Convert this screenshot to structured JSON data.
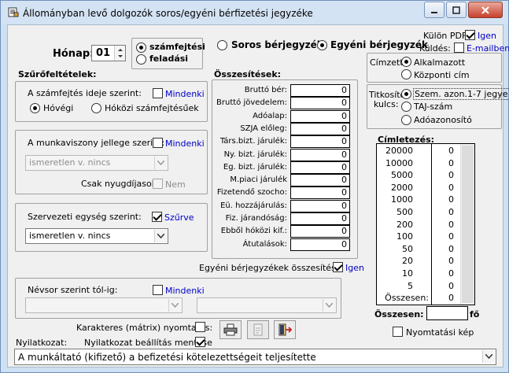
{
  "window": {
    "title": "Állományban levő dolgozók soros/egyéni bérfizetési jegyzéke"
  },
  "month": {
    "label": "Hónap:",
    "value": "01"
  },
  "mode": {
    "options": [
      "számfejtési",
      "feladási"
    ],
    "selected": 0
  },
  "filters": {
    "title": "Szűrőfeltételek:",
    "time": {
      "label": "A számfejtés ideje szerint:",
      "all": "Mindenki",
      "all_checked": false,
      "options": [
        "Hóvégi",
        "Hóközi számfejtésűek"
      ],
      "selected": 0
    },
    "employment": {
      "label": "A munkaviszony jellege szerint:",
      "all": "Mindenki",
      "all_checked": false,
      "value": "ismeretlen v. nincs",
      "pension_label": "Csak nyugdíjasok:",
      "pension_value": "Nem"
    },
    "org": {
      "label": "Szervezeti egység szerint:",
      "filtered": "Szűrve",
      "filtered_checked": true,
      "value": "ismeretlen v. nincs"
    },
    "names": {
      "label": "Névsor szerint tól-ig:",
      "all": "Mindenki",
      "all_checked": false
    }
  },
  "list_type": {
    "options": [
      "Soros bérjegyzék",
      "Egyéni bérjegyzék"
    ],
    "selected": 1
  },
  "pdf": {
    "label": "Külön PDF:",
    "value": "Igen",
    "checked": true,
    "send_label": "Küldés:",
    "email": "E-mailben",
    "email_checked": false
  },
  "recipient": {
    "label": "Címzett:",
    "options": [
      "Alkalmazott",
      "Központi cím"
    ],
    "selected": 0
  },
  "encryption": {
    "label1": "Titkosító",
    "label2": "kulcs:",
    "options": [
      "Szem. azon.1-7 jegye",
      "TAJ-szám",
      "Adóazonosító"
    ],
    "selected": 0
  },
  "summary": {
    "title": "Összesítések:",
    "rows": [
      {
        "label": "Bruttó bér:",
        "value": "0"
      },
      {
        "label": "Bruttó jövedelem:",
        "value": "0"
      },
      {
        "label": "Adóalap:",
        "value": "0"
      },
      {
        "label": "SZJA előleg:",
        "value": "0"
      },
      {
        "label": "Társ.bizt. járulék:",
        "value": "0"
      },
      {
        "label": "Ny. bizt. járulék:",
        "value": "0"
      },
      {
        "label": "Eg. bizt. járulék:",
        "value": "0"
      },
      {
        "label": "M.piaci járulék",
        "value": "0"
      },
      {
        "label": "Fizetendő szocho:",
        "value": "0"
      },
      {
        "label": "Eü. hozzájárulás:",
        "value": "0"
      },
      {
        "label": "Fiz. járandóság:",
        "value": "0"
      },
      {
        "label": "Ebből hóközi kif.:",
        "value": "0"
      },
      {
        "label": "Átutalások:",
        "value": "0"
      }
    ],
    "individual_label": "Egyéni bérjegyzékek összesítése:",
    "individual_value": "Igen",
    "individual_checked": true
  },
  "denominations": {
    "title": "Címletezés:",
    "rows": [
      {
        "denom": "20000",
        "count": "0"
      },
      {
        "denom": "10000",
        "count": "0"
      },
      {
        "denom": "5000",
        "count": "0"
      },
      {
        "denom": "2000",
        "count": "0"
      },
      {
        "denom": "1000",
        "count": "0"
      },
      {
        "denom": "500",
        "count": "0"
      },
      {
        "denom": "200",
        "count": "0"
      },
      {
        "denom": "100",
        "count": "0"
      },
      {
        "denom": "50",
        "count": "0"
      },
      {
        "denom": "20",
        "count": "0"
      },
      {
        "denom": "10",
        "count": "0"
      },
      {
        "denom": "5",
        "count": "0"
      },
      {
        "denom": "Összesen:",
        "count": "0"
      }
    ],
    "total_label": "Összesen:",
    "total_unit": "fő"
  },
  "print": {
    "matrix_label": "Karakteres (mátrix) nyomtatás:",
    "matrix_checked": false,
    "save_label": "Nyilatkozat beállítás mentése",
    "save_checked": true,
    "preview_label": "Nyomtatási kép",
    "preview_checked": false
  },
  "declaration": {
    "label": "Nyilatkozat:",
    "value": "A munkáltató (kifizető) a befizetési kötelezettségeit teljesítette"
  }
}
